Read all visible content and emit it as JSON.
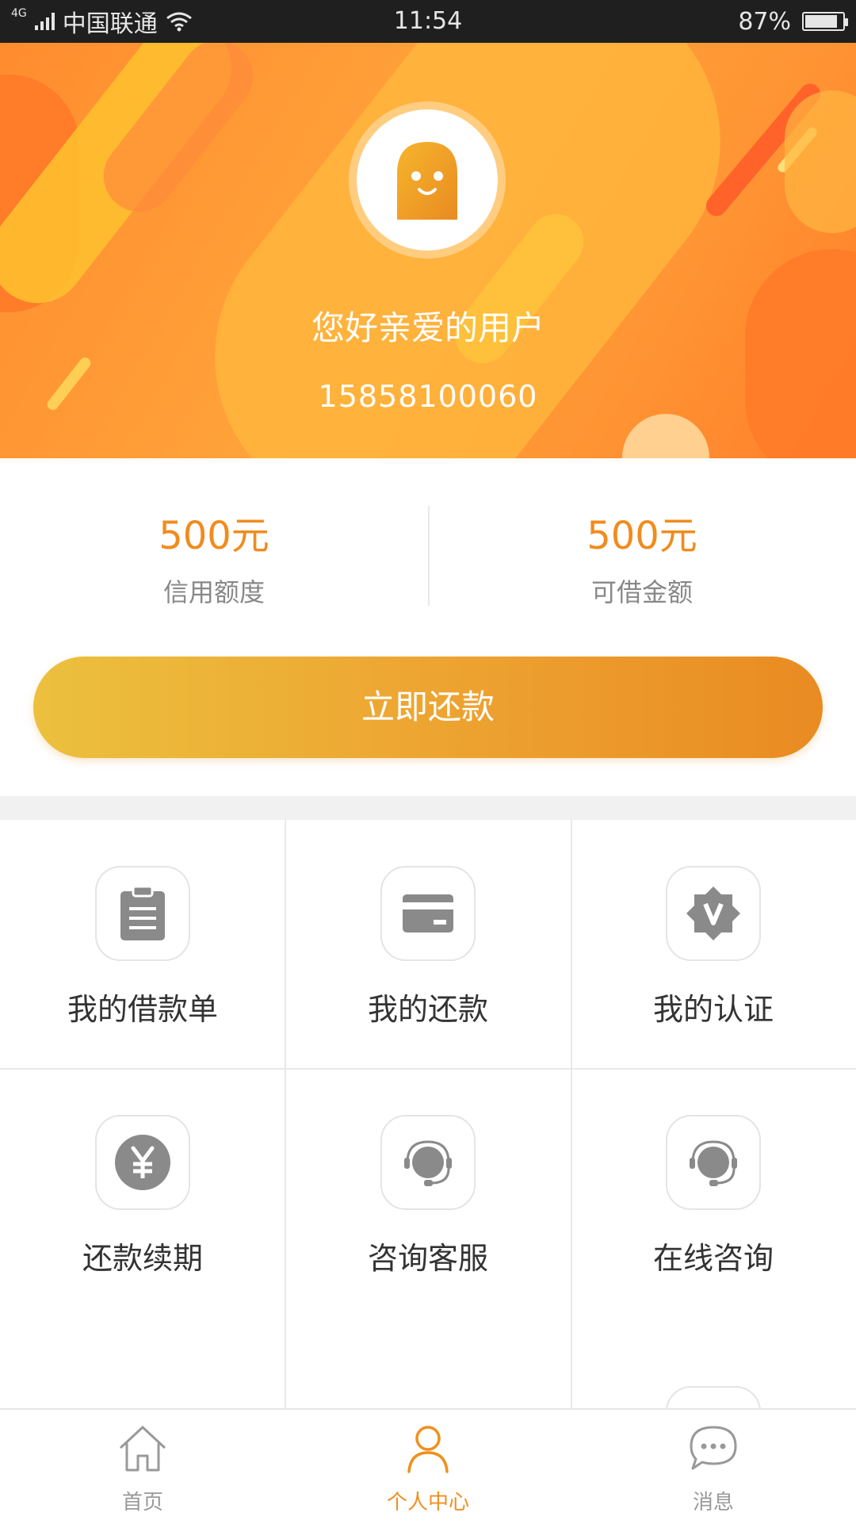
{
  "status_bar": {
    "network_type": "4G",
    "carrier": "中国联通",
    "time": "11:54",
    "battery": "87%",
    "battery_level": 0.87
  },
  "profile": {
    "greeting": "您好亲爱的用户",
    "phone": "15858100060",
    "avatar_icon": "mascot-avatar-icon"
  },
  "amounts": {
    "credit_value": "500元",
    "credit_label": "信用额度",
    "available_value": "500元",
    "available_label": "可借金额"
  },
  "repay_button": {
    "label": "立即还款"
  },
  "grid": {
    "items": [
      {
        "label": "我的借款单",
        "icon": "clipboard-icon"
      },
      {
        "label": "我的还款",
        "icon": "card-icon"
      },
      {
        "label": "我的认证",
        "icon": "verified-badge-icon"
      },
      {
        "label": "还款续期",
        "icon": "yen-icon"
      },
      {
        "label": "咨询客服",
        "icon": "headset-icon"
      },
      {
        "label": "在线咨询",
        "icon": "headset-icon"
      }
    ]
  },
  "bottom_nav": {
    "items": [
      {
        "label": "首页",
        "icon": "home-icon"
      },
      {
        "label": "个人中心",
        "icon": "person-icon",
        "active": true
      },
      {
        "label": "消息",
        "icon": "message-icon"
      }
    ]
  },
  "colors": {
    "accent": "#f08c1e",
    "header_orange": "#ff9a35",
    "button_start": "#ecc03e",
    "button_end": "#e98b22",
    "icon_gray": "#8a8a8a"
  }
}
